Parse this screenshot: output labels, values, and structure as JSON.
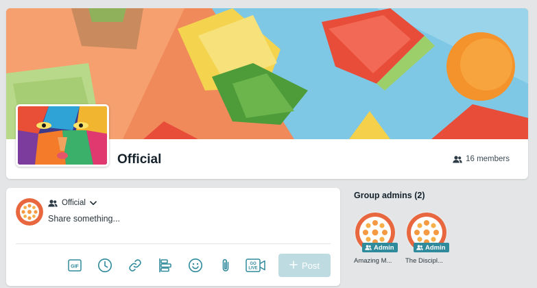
{
  "group": {
    "name": "Official",
    "members_count": "16 members"
  },
  "composer": {
    "audience": "Official",
    "placeholder": "Share something...",
    "post_label": "Post",
    "tools": [
      "gif-icon",
      "clock-icon",
      "link-icon",
      "poll-icon",
      "emoji-icon",
      "attachment-icon",
      "go-live-icon"
    ]
  },
  "admins": {
    "title": "Group admins (2)",
    "badge_label": "Admin",
    "items": [
      {
        "name": "Amazing M..."
      },
      {
        "name": "The Discipl..."
      }
    ]
  },
  "colors": {
    "accent": "#2f8a9c",
    "post_disabled": "#bfdbe2",
    "avatar_orange": "#e9673f"
  }
}
